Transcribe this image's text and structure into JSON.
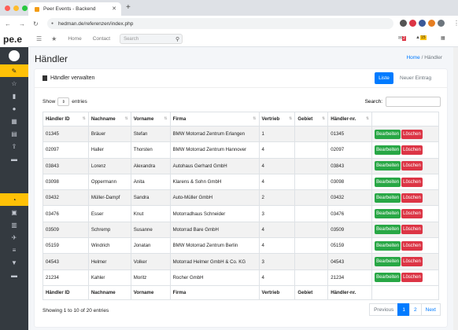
{
  "browser": {
    "tab_title": "Peer Events - Backend",
    "url": "hedman.de/referenzen/index.php"
  },
  "sidebar": {
    "logo": "pe.e"
  },
  "topnav": {
    "home": "Home",
    "contact": "Contact",
    "search_placeholder": "Search",
    "badge1": "2",
    "badge2": "15"
  },
  "page": {
    "title": "Händler",
    "breadcrumb_home": "Home",
    "breadcrumb_sep": "/",
    "breadcrumb_current": "Händler"
  },
  "card": {
    "title": "Händler verwalten",
    "btn_list": "Liste",
    "btn_new": "Neuer Eintrag"
  },
  "table_ctrl": {
    "show": "Show",
    "entries": "entries",
    "search_label": "Search:"
  },
  "columns": [
    "Händler ID",
    "Nachname",
    "Vorname",
    "Firma",
    "Vertrieb",
    "Gebiet",
    "Händler-nr.",
    ""
  ],
  "rows": [
    [
      "01345",
      "Bräuer",
      "Stefan",
      "BMW Motorrad Zentrum Erlangen",
      "1",
      "",
      "01345"
    ],
    [
      "02097",
      "Haller",
      "Thorsten",
      "BMW Motorrad Zentrum Hannover",
      "4",
      "",
      "02097"
    ],
    [
      "03843",
      "Lorenz",
      "Alexandra",
      "Autohaus Gerhard GmbH",
      "4",
      "",
      "03843"
    ],
    [
      "03098",
      "Oppermann",
      "Anita",
      "Klarens & Sohn GmbH",
      "4",
      "",
      "03098"
    ],
    [
      "03432",
      "Müller-Dampf",
      "Sandra",
      "Auto-Müller GmbH",
      "2",
      "",
      "03432"
    ],
    [
      "03476",
      "Esser",
      "Knut",
      "Motorradhaus Schneider",
      "3",
      "",
      "03476"
    ],
    [
      "03509",
      "Schremp",
      "Susanne",
      "Motorrad Bare GmbH",
      "4",
      "",
      "03509"
    ],
    [
      "05159",
      "Windrich",
      "Jonatan",
      "BMW Motorrad Zentrum Berlin",
      "4",
      "",
      "05159"
    ],
    [
      "04543",
      "Helmer",
      "Volker",
      "Motorrad Helmer GmbH & Co. KG",
      "3",
      "",
      "04543"
    ],
    [
      "21234",
      "Kahler",
      "Moritz",
      "Rocher GmbH",
      "4",
      "",
      "21234"
    ]
  ],
  "row_actions": {
    "edit": "Bearbeiten",
    "delete": "Löschen"
  },
  "footer": {
    "info": "Showing 1 to 10 of 20 entries",
    "prev": "Previous",
    "p1": "1",
    "p2": "2",
    "next": "Next"
  }
}
